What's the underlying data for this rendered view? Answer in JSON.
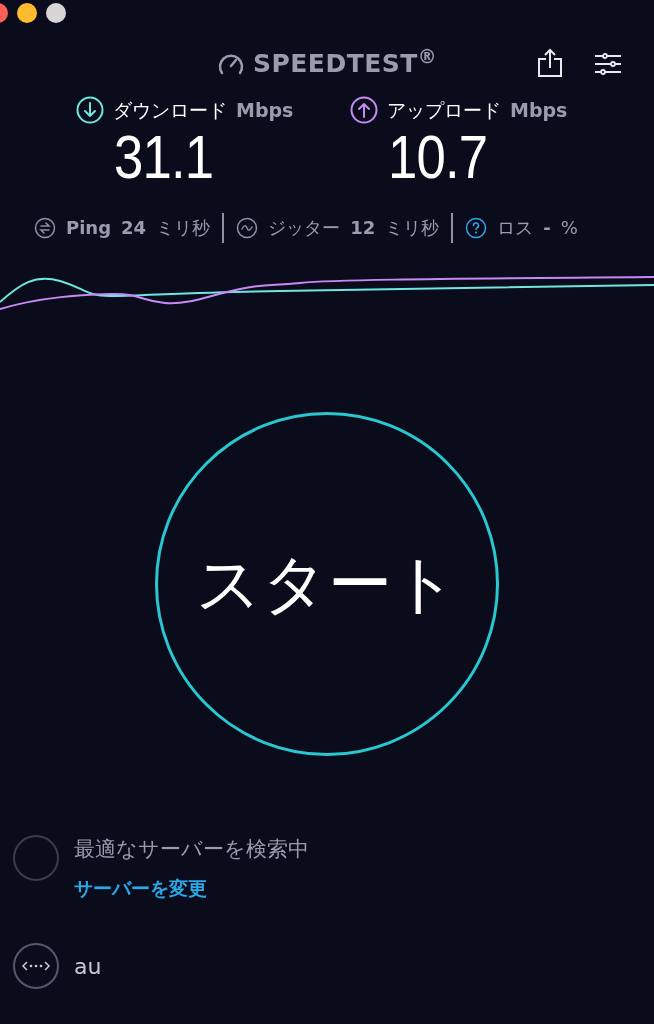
{
  "window": {
    "controls": [
      {
        "color": "#fe5f57"
      },
      {
        "color": "#fdbb2e"
      },
      {
        "color": "#d6d6d6"
      }
    ]
  },
  "header": {
    "logo": "SPEEDTEST$^{®}$"
  },
  "results": [
    {
      "kind": "download",
      "label": "ダウンロード",
      "unit": "Mbps",
      "value": "31.1"
    },
    {
      "kind": "upload",
      "label": "アップロード",
      "unit": "Mbps",
      "value": "10.7"
    }
  ],
  "stats": [
    {
      "kind": "ping",
      "label": "Ping",
      "value": "24",
      "unit": "ミリ秒"
    },
    {
      "kind": "jitter",
      "label": "ジッター",
      "value": "12",
      "unit": "ミリ秒"
    },
    {
      "kind": "loss",
      "label": "ロス",
      "value": "-",
      "unit": "%"
    }
  ],
  "start_button": "スタート",
  "server": {
    "status": "最適なサーバーを検索中",
    "change_link": "サーバーを変更"
  },
  "provider": {
    "name": "au"
  }
}
